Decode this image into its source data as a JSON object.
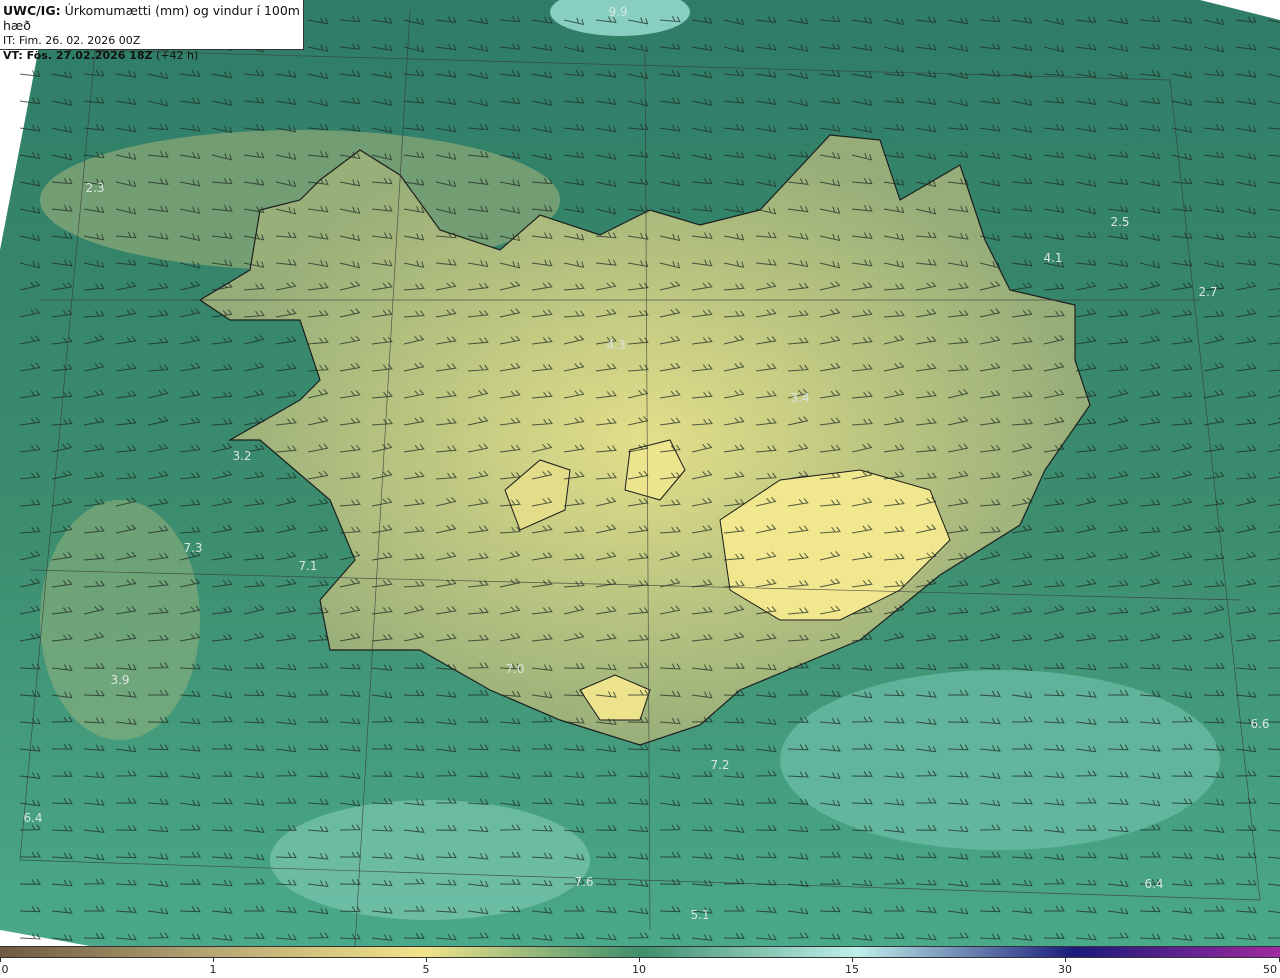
{
  "title": {
    "prefix": "UWC/IG:",
    "main": " Úrkomumætti (mm) og vindur í 100m hæð",
    "init_time": "IT: Fim. 26. 02. 2026 00Z",
    "valid_prefix": "VT: Fös. 27.02.2026 18Z",
    "valid_suffix": " (+42 h)"
  },
  "value_labels": [
    "9.9",
    "2.3",
    "2.5",
    "4.1",
    "2.7",
    "4.3",
    "3.4",
    "3.2",
    "7.3",
    "7.1",
    "7.0",
    "3.9",
    "7.2",
    "6.4",
    "7.6",
    "5.1",
    "6.4",
    "6.6"
  ],
  "colorbar": {
    "ticks": [
      "0",
      "1",
      "5",
      "10",
      "15",
      "30",
      "50"
    ],
    "stops": [
      "#6e5a42",
      "#b8a874",
      "#f2e48a",
      "#3f8e6c",
      "#bff0ea",
      "#1a1a7a",
      "#a02aa0"
    ]
  },
  "colors": {
    "ocean_dark": "#2f7d68",
    "land_light": "#e8e08a",
    "coast_line": "#1a1a1a",
    "grid_line": "#3a3a3a"
  }
}
